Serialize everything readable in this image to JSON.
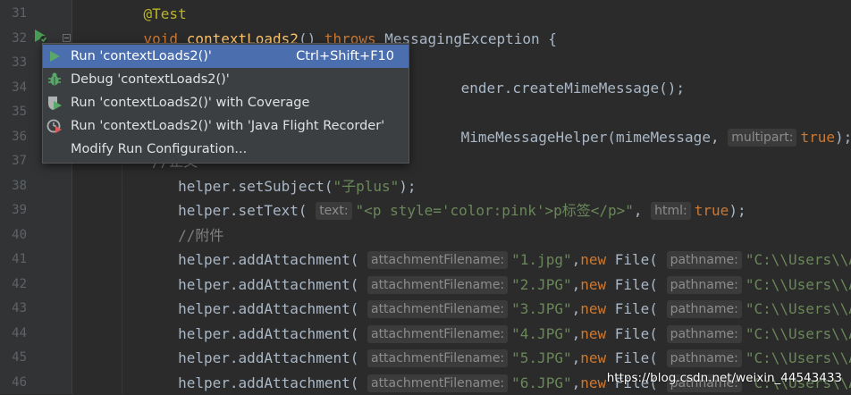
{
  "lines": [
    {
      "num": "31",
      "indent": "    ",
      "parts": [
        {
          "text": "@Test",
          "cls": "ann"
        }
      ]
    },
    {
      "num": "32",
      "indent": "    ",
      "parts": [
        {
          "text": "void ",
          "cls": "kw"
        },
        {
          "text": "contextLoads2",
          "cls": "fn"
        },
        {
          "text": "() ",
          "cls": ""
        },
        {
          "text": "throws ",
          "cls": "kw"
        },
        {
          "text": "MessagingException {",
          "cls": ""
        }
      ]
    },
    {
      "num": "33",
      "indent": "",
      "parts": []
    },
    {
      "num": "34",
      "indent": "",
      "parts": [
        {
          "text": "ender.createMimeMessage();",
          "cls": "",
          "col": 41
        }
      ]
    },
    {
      "num": "35",
      "indent": "",
      "parts": []
    },
    {
      "num": "36",
      "indent": "",
      "parts": [
        {
          "text": "MimeMessageHelper(mimeMessage, ",
          "cls": "",
          "col": 41
        },
        {
          "text": "multipart:",
          "cls": "hint"
        },
        {
          "text": "true",
          "cls": "kw"
        },
        {
          "text": ");",
          "cls": ""
        }
      ]
    },
    {
      "num": "37",
      "indent": "",
      "parts": [
        {
          "text": "//正文",
          "cls": "cmt",
          "col": 5
        }
      ]
    },
    {
      "num": "38",
      "indent": "        ",
      "parts": [
        {
          "text": "helper.setSubject(",
          "cls": ""
        },
        {
          "text": "\"子plus\"",
          "cls": "str"
        },
        {
          "text": ");",
          "cls": ""
        }
      ]
    },
    {
      "num": "39",
      "indent": "        ",
      "parts": [
        {
          "text": "helper.setText( ",
          "cls": ""
        },
        {
          "text": "text:",
          "cls": "hint"
        },
        {
          "text": "\"<p style='color:pink'>p标签</p>\"",
          "cls": "str"
        },
        {
          "text": ", ",
          "cls": ""
        },
        {
          "text": "html:",
          "cls": "hint"
        },
        {
          "text": "true",
          "cls": "kw"
        },
        {
          "text": ");",
          "cls": ""
        }
      ]
    },
    {
      "num": "40",
      "indent": "        ",
      "parts": [
        {
          "text": "//附件",
          "cls": "cmt"
        }
      ]
    },
    {
      "num": "41",
      "indent": "        ",
      "parts": [
        {
          "text": "helper.addAttachment( ",
          "cls": ""
        },
        {
          "text": "attachmentFilename:",
          "cls": "hint"
        },
        {
          "text": "\"1.jpg\"",
          "cls": "str"
        },
        {
          "text": ",",
          "cls": ""
        },
        {
          "text": "new ",
          "cls": "kw"
        },
        {
          "text": "File( ",
          "cls": ""
        },
        {
          "text": "pathname:",
          "cls": "hint"
        },
        {
          "text": "\"C:\\\\Users\\\\Adm",
          "cls": "str"
        }
      ]
    },
    {
      "num": "42",
      "indent": "        ",
      "parts": [
        {
          "text": "helper.addAttachment( ",
          "cls": ""
        },
        {
          "text": "attachmentFilename:",
          "cls": "hint"
        },
        {
          "text": "\"2.JPG\"",
          "cls": "str"
        },
        {
          "text": ",",
          "cls": ""
        },
        {
          "text": "new ",
          "cls": "kw"
        },
        {
          "text": "File( ",
          "cls": ""
        },
        {
          "text": "pathname:",
          "cls": "hint"
        },
        {
          "text": "\"C:\\\\Users\\\\Adm",
          "cls": "str"
        }
      ]
    },
    {
      "num": "43",
      "indent": "        ",
      "parts": [
        {
          "text": "helper.addAttachment( ",
          "cls": ""
        },
        {
          "text": "attachmentFilename:",
          "cls": "hint"
        },
        {
          "text": "\"3.JPG\"",
          "cls": "str"
        },
        {
          "text": ",",
          "cls": ""
        },
        {
          "text": "new ",
          "cls": "kw"
        },
        {
          "text": "File( ",
          "cls": ""
        },
        {
          "text": "pathname:",
          "cls": "hint"
        },
        {
          "text": "\"C:\\\\Users\\\\Adm",
          "cls": "str"
        }
      ]
    },
    {
      "num": "44",
      "indent": "        ",
      "parts": [
        {
          "text": "helper.addAttachment( ",
          "cls": ""
        },
        {
          "text": "attachmentFilename:",
          "cls": "hint"
        },
        {
          "text": "\"4.JPG\"",
          "cls": "str"
        },
        {
          "text": ",",
          "cls": ""
        },
        {
          "text": "new ",
          "cls": "kw"
        },
        {
          "text": "File( ",
          "cls": ""
        },
        {
          "text": "pathname:",
          "cls": "hint"
        },
        {
          "text": "\"C:\\\\Users\\\\Adm",
          "cls": "str"
        }
      ]
    },
    {
      "num": "45",
      "indent": "        ",
      "parts": [
        {
          "text": "helper.addAttachment( ",
          "cls": ""
        },
        {
          "text": "attachmentFilename:",
          "cls": "hint"
        },
        {
          "text": "\"5.JPG\"",
          "cls": "str"
        },
        {
          "text": ",",
          "cls": ""
        },
        {
          "text": "new ",
          "cls": "kw"
        },
        {
          "text": "File( ",
          "cls": ""
        },
        {
          "text": "pathname:",
          "cls": "hint"
        },
        {
          "text": "\"C:\\\\Users\\\\Adm",
          "cls": "str"
        }
      ]
    },
    {
      "num": "46",
      "indent": "        ",
      "parts": [
        {
          "text": "helper.addAttachment( ",
          "cls": ""
        },
        {
          "text": "attachmentFilename:",
          "cls": "hint"
        },
        {
          "text": "\"6.JPG\"",
          "cls": "str"
        },
        {
          "text": ",",
          "cls": ""
        },
        {
          "text": "new ",
          "cls": "kw"
        },
        {
          "text": "File( ",
          "cls": ""
        },
        {
          "text": "pathname:",
          "cls": "hint"
        },
        {
          "text": "\"C:\\\\Users\\\\Adm",
          "cls": "str"
        }
      ]
    }
  ],
  "menu": {
    "items": [
      {
        "id": "run",
        "label": "Run 'contextLoads2()'",
        "shortcut": "Ctrl+Shift+F10",
        "icon": "run-icon",
        "selected": true
      },
      {
        "id": "debug",
        "label": "Debug 'contextLoads2()'",
        "shortcut": "",
        "icon": "debug-icon",
        "selected": false
      },
      {
        "id": "coverage",
        "label": "Run 'contextLoads2()' with Coverage",
        "shortcut": "",
        "icon": "coverage-icon",
        "selected": false
      },
      {
        "id": "jfr",
        "label": "Run 'contextLoads2()' with 'Java Flight Recorder'",
        "shortcut": "",
        "icon": "flight-recorder-icon",
        "selected": false
      },
      {
        "id": "modify",
        "label": "Modify Run Configuration...",
        "shortcut": "",
        "icon": "",
        "selected": false
      }
    ]
  },
  "gutter": {
    "run_icon": "run-gutter-icon",
    "fold_icon": "fold-icon"
  },
  "watermark": "https://blog.csdn.net/weixin_44543433",
  "colors": {
    "background": "#2b2b2b",
    "gutter": "#313335",
    "keyword": "#cc7832",
    "string": "#6a8759",
    "annotation": "#bbb529",
    "function": "#ffc66d",
    "comment": "#808080",
    "menu_background": "#3c3f41",
    "menu_selected": "#4b6eaf"
  }
}
